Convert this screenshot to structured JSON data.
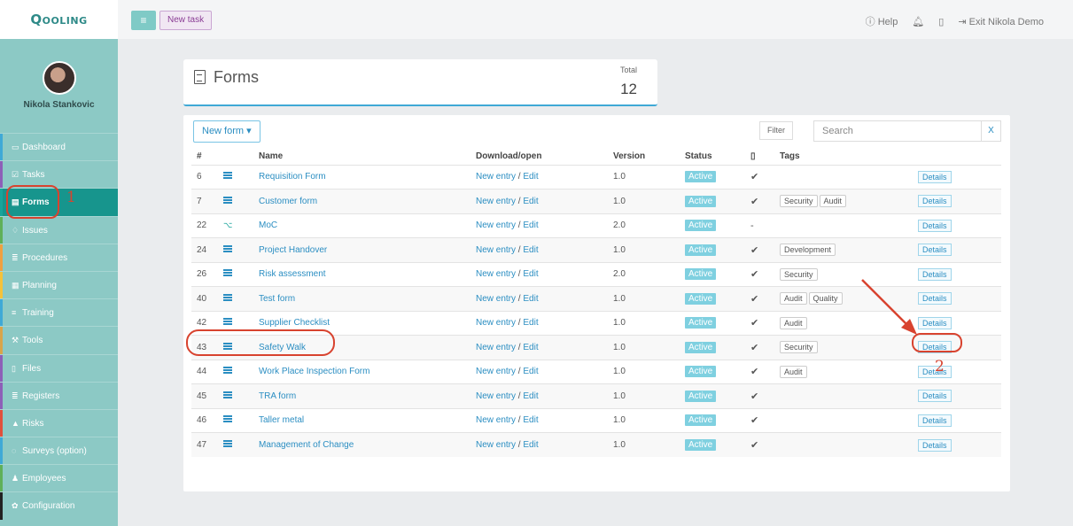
{
  "topbar": {
    "logo": "Qooling",
    "new_task": "New task",
    "help": "Help",
    "exit": "Exit Nikola Demo"
  },
  "profile": {
    "name": "Nikola Stankovic"
  },
  "nav": [
    {
      "label": "Dashboard",
      "icon": "monitor-icon",
      "glyph": "▭",
      "color": "#3fa9d6"
    },
    {
      "label": "Tasks",
      "icon": "check-icon",
      "glyph": "☑",
      "color": "#8d5fb8"
    },
    {
      "label": "Forms",
      "icon": "document-icon",
      "glyph": "▤",
      "color": "#19a39a",
      "active": true
    },
    {
      "label": "Issues",
      "icon": "bell-icon",
      "glyph": "♢",
      "color": "#5fb05a"
    },
    {
      "label": "Procedures",
      "icon": "list-icon",
      "glyph": "≣",
      "color": "#f0a040"
    },
    {
      "label": "Planning",
      "icon": "calendar-icon",
      "glyph": "▦",
      "color": "#f5c23a"
    },
    {
      "label": "Training",
      "icon": "graduation-icon",
      "glyph": "≡",
      "color": "#3fa9d6"
    },
    {
      "label": "Tools",
      "icon": "wrench-icon",
      "glyph": "⚒",
      "color": "#d9a54a"
    },
    {
      "label": "Files",
      "icon": "file-icon",
      "glyph": "▯",
      "color": "#8d5fb8"
    },
    {
      "label": "Registers",
      "icon": "register-icon",
      "glyph": "≣",
      "color": "#8d5fb8"
    },
    {
      "label": "Risks",
      "icon": "warning-icon",
      "glyph": "▲",
      "color": "#e0503c"
    },
    {
      "label": "Surveys (option)",
      "icon": "chat-icon",
      "glyph": "◌",
      "color": "#3fa9d6"
    },
    {
      "label": "Employees",
      "icon": "users-icon",
      "glyph": "♟",
      "color": "#5fb05a"
    },
    {
      "label": "Configuration",
      "icon": "gear-icon",
      "glyph": "✿",
      "color": "#222222"
    }
  ],
  "header": {
    "title": "Forms",
    "total_label": "Total",
    "total_value": "12"
  },
  "toolbar": {
    "new_form": "New form ▾",
    "filter": "Filter",
    "search_placeholder": "Search",
    "clear": "X"
  },
  "columns": [
    "#",
    "",
    "Name",
    "Download/open",
    "Version",
    "Status",
    "",
    "Tags",
    ""
  ],
  "row_labels": {
    "new_entry": "New entry",
    "sep": " / ",
    "edit": "Edit",
    "details": "Details"
  },
  "rows": [
    {
      "id": "6",
      "icon": "list",
      "name": "Requisition Form",
      "version": "1.0",
      "status": "Active",
      "check": "✔",
      "tags": []
    },
    {
      "id": "7",
      "icon": "list",
      "name": "Customer form",
      "version": "1.0",
      "status": "Active",
      "check": "✔",
      "tags": [
        "Security",
        "Audit"
      ]
    },
    {
      "id": "22",
      "icon": "flow",
      "name": "MoC",
      "version": "2.0",
      "status": "Active",
      "check": "-",
      "tags": []
    },
    {
      "id": "24",
      "icon": "list",
      "name": "Project Handover",
      "version": "1.0",
      "status": "Active",
      "check": "✔",
      "tags": [
        "Development"
      ]
    },
    {
      "id": "26",
      "icon": "list",
      "name": "Risk assessment",
      "version": "2.0",
      "status": "Active",
      "check": "✔",
      "tags": [
        "Security"
      ]
    },
    {
      "id": "40",
      "icon": "list",
      "name": "Test form",
      "version": "1.0",
      "status": "Active",
      "check": "✔",
      "tags": [
        "Audit",
        "Quality"
      ]
    },
    {
      "id": "42",
      "icon": "list",
      "name": "Supplier Checklist",
      "version": "1.0",
      "status": "Active",
      "check": "✔",
      "tags": [
        "Audit"
      ]
    },
    {
      "id": "43",
      "icon": "list",
      "name": "Safety Walk",
      "version": "1.0",
      "status": "Active",
      "check": "✔",
      "tags": [
        "Security"
      ]
    },
    {
      "id": "44",
      "icon": "list",
      "name": "Work Place Inspection Form",
      "version": "1.0",
      "status": "Active",
      "check": "✔",
      "tags": [
        "Audit"
      ]
    },
    {
      "id": "45",
      "icon": "list",
      "name": "TRA form",
      "version": "1.0",
      "status": "Active",
      "check": "✔",
      "tags": []
    },
    {
      "id": "46",
      "icon": "list",
      "name": "Taller metal",
      "version": "1.0",
      "status": "Active",
      "check": "✔",
      "tags": []
    },
    {
      "id": "47",
      "icon": "list",
      "name": "Management of Change",
      "version": "1.0",
      "status": "Active",
      "check": "✔",
      "tags": []
    }
  ],
  "annotations": {
    "step1": "1",
    "step2": "2",
    "color": "#d8432f"
  }
}
